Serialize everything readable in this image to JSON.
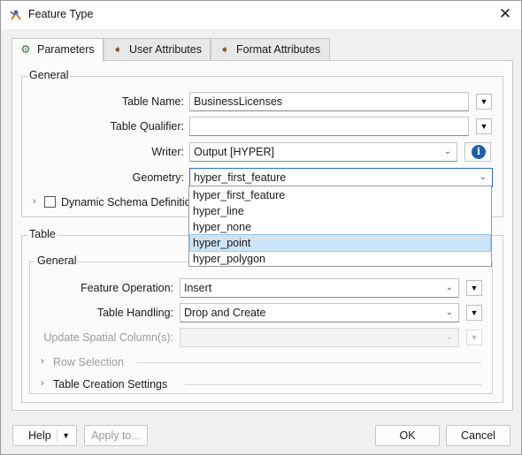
{
  "window": {
    "title": "Feature Type",
    "close_glyph": "✕"
  },
  "tabs": [
    {
      "label": "Parameters",
      "icon": "gear-icon",
      "glyph": "⚙",
      "active": true
    },
    {
      "label": "User Attributes",
      "icon": "arrow-right-icon",
      "glyph": "➧",
      "active": false
    },
    {
      "label": "Format Attributes",
      "icon": "arrow-right-icon",
      "glyph": "➧",
      "active": false
    }
  ],
  "general": {
    "title": "General",
    "table_name": {
      "label": "Table Name:",
      "value": "BusinessLicenses"
    },
    "table_qualifier": {
      "label": "Table Qualifier:",
      "value": ""
    },
    "writer": {
      "label": "Writer:",
      "value": "Output [HYPER]"
    },
    "geometry": {
      "label": "Geometry:",
      "value": "hyper_first_feature"
    },
    "dynamic_schema": {
      "label": "Dynamic Schema Definition",
      "checked": false
    },
    "menu_glyph": "▼",
    "info_glyph": "i",
    "chevron_glyph": "⌄",
    "expand_glyph": "›"
  },
  "geometry_options": [
    {
      "label": "hyper_first_feature",
      "highlighted": false
    },
    {
      "label": "hyper_line",
      "highlighted": false
    },
    {
      "label": "hyper_none",
      "highlighted": false
    },
    {
      "label": "hyper_point",
      "highlighted": true
    },
    {
      "label": "hyper_polygon",
      "highlighted": false
    }
  ],
  "table": {
    "title": "Table",
    "general_title": "General",
    "feature_operation": {
      "label": "Feature Operation:",
      "value": "Insert"
    },
    "table_handling": {
      "label": "Table Handling:",
      "value": "Drop and Create"
    },
    "update_spatial": {
      "label": "Update Spatial Column(s):",
      "value": ""
    },
    "row_selection": "Row Selection",
    "table_creation": "Table Creation Settings"
  },
  "footer": {
    "help": "Help",
    "apply_to": "Apply to...",
    "ok": "OK",
    "cancel": "Cancel",
    "caret": "▼"
  },
  "colors": {
    "accent": "#2c6fbd",
    "highlight": "#cce4f7",
    "info_icon": "#1f5fa8"
  }
}
